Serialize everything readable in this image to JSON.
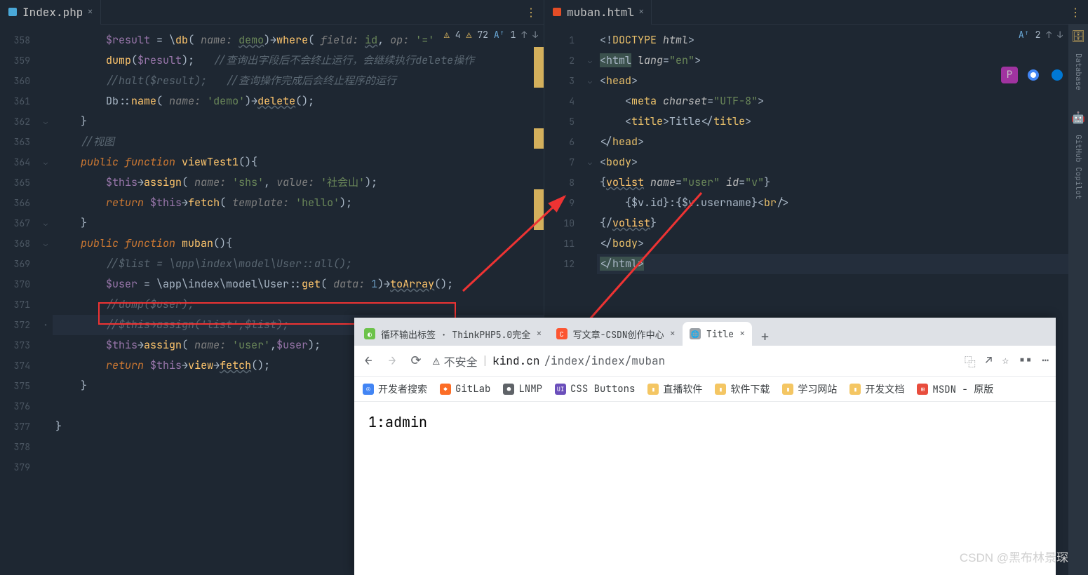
{
  "ide": {
    "tab_left": {
      "name": "Index.php"
    },
    "tab_right": {
      "name": "muban.html"
    },
    "status_left": {
      "warn1": "4",
      "warn2": "72",
      "typo": "1"
    },
    "status_right": {
      "typo": "2"
    },
    "sidebar": {
      "database": "Database",
      "copilot": "GitHub Copilot"
    }
  },
  "left_gutter": [
    "358",
    "359",
    "360",
    "361",
    "362",
    "363",
    "364",
    "365",
    "366",
    "367",
    "368",
    "369",
    "370",
    "371",
    "372",
    "373",
    "374",
    "375",
    "376",
    "377",
    "378",
    "379"
  ],
  "right_gutter": [
    "1",
    "2",
    "3",
    "4",
    "5",
    "6",
    "7",
    "8",
    "9",
    "10",
    "11",
    "12"
  ],
  "left_code": [
    {
      "i": "        ",
      "t": [
        [
          "var",
          "$result"
        ],
        [
          "op",
          " = \\"
        ],
        [
          "fn",
          "db"
        ],
        [
          "op",
          "( "
        ],
        [
          "param",
          "name: "
        ],
        [
          "str und",
          "demo"
        ],
        [
          "op",
          ")→"
        ],
        [
          "fn",
          "where"
        ],
        [
          "op",
          "( "
        ],
        [
          "param",
          "field: "
        ],
        [
          "str und",
          "id"
        ],
        [
          "op",
          ", "
        ],
        [
          "param",
          "op: "
        ],
        [
          "str",
          "'='"
        ],
        [
          "op",
          "  "
        ]
      ]
    },
    {
      "i": "        ",
      "t": [
        [
          "fn",
          "dump"
        ],
        [
          "op",
          "("
        ],
        [
          "var",
          "$result"
        ],
        [
          "op",
          ");   "
        ],
        [
          "cm",
          "//查询出字段后不会终止运行，会继续执行delete操作"
        ]
      ]
    },
    {
      "i": "        ",
      "t": [
        [
          "cm",
          "//halt($result);   //查询操作完成后会终止程序的运行"
        ]
      ]
    },
    {
      "i": "        ",
      "t": [
        [
          "op",
          "Db::"
        ],
        [
          "fn",
          "name"
        ],
        [
          "op",
          "( "
        ],
        [
          "param",
          "name: "
        ],
        [
          "str",
          "'demo'"
        ],
        [
          "op",
          ")→"
        ],
        [
          "fn und",
          "delete"
        ],
        [
          "op",
          "();"
        ]
      ]
    },
    {
      "i": "    ",
      "t": [
        [
          "op",
          "}"
        ]
      ]
    },
    {
      "i": "    ",
      "t": [
        [
          "cm",
          "//视图"
        ]
      ]
    },
    {
      "i": "    ",
      "t": [
        [
          "kw",
          "public function "
        ],
        [
          "fn",
          "viewTest1"
        ],
        [
          "op",
          "(){"
        ]
      ]
    },
    {
      "i": "        ",
      "t": [
        [
          "var",
          "$this"
        ],
        [
          "op",
          "→"
        ],
        [
          "fn",
          "assign"
        ],
        [
          "op",
          "( "
        ],
        [
          "param",
          "name: "
        ],
        [
          "str",
          "'shs'"
        ],
        [
          "op",
          ", "
        ],
        [
          "param",
          "value: "
        ],
        [
          "str",
          "'社会山'"
        ],
        [
          "op",
          ");"
        ]
      ]
    },
    {
      "i": "        ",
      "t": [
        [
          "kw",
          "return "
        ],
        [
          "var",
          "$this"
        ],
        [
          "op",
          "→"
        ],
        [
          "fn",
          "fetch"
        ],
        [
          "op",
          "( "
        ],
        [
          "param",
          "template: "
        ],
        [
          "str",
          "'hello'"
        ],
        [
          "op",
          ");"
        ]
      ]
    },
    {
      "i": "    ",
      "t": [
        [
          "op",
          "}"
        ]
      ]
    },
    {
      "i": "    ",
      "t": [
        [
          "kw",
          "public function "
        ],
        [
          "fn",
          "muban"
        ],
        [
          "op",
          "(){"
        ]
      ]
    },
    {
      "i": "        ",
      "t": [
        [
          "cm",
          "//$list = \\app\\index\\model\\User::all();"
        ]
      ]
    },
    {
      "i": "        ",
      "t": [
        [
          "var",
          "$user"
        ],
        [
          "op",
          " = \\app\\index\\model\\User::"
        ],
        [
          "fn",
          "get"
        ],
        [
          "op",
          "( "
        ],
        [
          "param",
          "data: "
        ],
        [
          "num",
          "1"
        ],
        [
          "op",
          ")→"
        ],
        [
          "fn und",
          "toArray"
        ],
        [
          "op",
          "();"
        ]
      ]
    },
    {
      "i": "        ",
      "t": [
        [
          "cm",
          "//dump($user);"
        ]
      ]
    },
    {
      "i": "        ",
      "t": [
        [
          "cm",
          "//$this→assign('list',$list);"
        ]
      ]
    },
    {
      "i": "        ",
      "t": [
        [
          "var",
          "$this"
        ],
        [
          "op",
          "→"
        ],
        [
          "fn",
          "assign"
        ],
        [
          "op",
          "( "
        ],
        [
          "param",
          "name: "
        ],
        [
          "str",
          "'user'"
        ],
        [
          "op",
          ","
        ],
        [
          "var",
          "$user"
        ],
        [
          "op",
          ");"
        ]
      ]
    },
    {
      "i": "        ",
      "t": [
        [
          "kw",
          "return "
        ],
        [
          "var",
          "$this"
        ],
        [
          "op",
          "→"
        ],
        [
          "fn",
          "view"
        ],
        [
          "op",
          "→"
        ],
        [
          "fn und",
          "fetch"
        ],
        [
          "op",
          "();"
        ]
      ]
    },
    {
      "i": "    ",
      "t": [
        [
          "op",
          "}"
        ]
      ]
    },
    {
      "i": "",
      "t": []
    },
    {
      "i": "",
      "t": [
        [
          "op",
          "}"
        ]
      ]
    },
    {
      "i": "",
      "t": []
    },
    {
      "i": "",
      "t": []
    }
  ],
  "right_code": [
    {
      "i": "",
      "t": [
        [
          "op",
          "<!"
        ],
        [
          "tag",
          "DOCTYPE "
        ],
        [
          "attr",
          "html"
        ],
        [
          "op",
          ">"
        ]
      ]
    },
    {
      "i": "",
      "t": [
        [
          "op hl-tag",
          "<html"
        ],
        [
          "attr",
          " lang"
        ],
        [
          "op",
          "="
        ],
        [
          "str",
          "\"en\""
        ],
        [
          "op",
          ">"
        ]
      ]
    },
    {
      "i": "",
      "t": [
        [
          "op",
          "<"
        ],
        [
          "tag",
          "head"
        ],
        [
          "op",
          ">"
        ]
      ]
    },
    {
      "i": "    ",
      "t": [
        [
          "op",
          "<"
        ],
        [
          "tag",
          "meta "
        ],
        [
          "attr",
          "charset"
        ],
        [
          "op",
          "="
        ],
        [
          "str",
          "\"UTF-8\""
        ],
        [
          "op",
          ">"
        ]
      ]
    },
    {
      "i": "    ",
      "t": [
        [
          "op",
          "<"
        ],
        [
          "tag",
          "title"
        ],
        [
          "op",
          ">Title</"
        ],
        [
          "tag",
          "title"
        ],
        [
          "op",
          ">"
        ]
      ]
    },
    {
      "i": "",
      "t": [
        [
          "op",
          "</"
        ],
        [
          "tag",
          "head"
        ],
        [
          "op",
          ">"
        ]
      ]
    },
    {
      "i": "",
      "t": [
        [
          "op",
          "<"
        ],
        [
          "tag",
          "body"
        ],
        [
          "op",
          ">"
        ]
      ]
    },
    {
      "i": "",
      "t": [
        [
          "op",
          "{"
        ],
        [
          "fn und",
          "volist"
        ],
        [
          "attr",
          " name"
        ],
        [
          "op",
          "="
        ],
        [
          "str",
          "\"user\""
        ],
        [
          "attr",
          " id"
        ],
        [
          "op",
          "="
        ],
        [
          "str",
          "\"v\""
        ],
        [
          "op",
          "}"
        ]
      ]
    },
    {
      "i": "    ",
      "t": [
        [
          "op",
          "{$v.id}:{$v.username}<"
        ],
        [
          "tag",
          "br"
        ],
        [
          "op",
          "/>"
        ]
      ]
    },
    {
      "i": "",
      "t": [
        [
          "op",
          "{/"
        ],
        [
          "fn und",
          "volist"
        ],
        [
          "op",
          "}"
        ]
      ]
    },
    {
      "i": "",
      "t": [
        [
          "op",
          "</"
        ],
        [
          "tag",
          "body"
        ],
        [
          "op",
          ">"
        ]
      ]
    },
    {
      "i": "",
      "t": [
        [
          "op hl-tag",
          "</html>"
        ]
      ]
    }
  ],
  "browser": {
    "tabs": [
      {
        "title": "循环输出标签 · ThinkPHP5.0完全",
        "favicon_bg": "#6cc24a",
        "favicon_txt": "◐",
        "active": false
      },
      {
        "title": "写文章-CSDN创作中心",
        "favicon_bg": "#fc5531",
        "favicon_txt": "C",
        "active": false
      },
      {
        "title": "Title",
        "favicon_bg": "#9aa0a6",
        "favicon_txt": "🌐",
        "active": true
      }
    ],
    "url_unsafe": "不安全",
    "url_host": "kind.cn",
    "url_path": "/index/index/muban",
    "bookmarks": [
      {
        "label": "开发者搜索",
        "color": "#4285f4",
        "glyph": "◎"
      },
      {
        "label": "GitLab",
        "color": "#fc6d26",
        "glyph": "◆"
      },
      {
        "label": "LNMP",
        "color": "#5f6368",
        "glyph": "●"
      },
      {
        "label": "CSS Buttons",
        "color": "#6b4fbb",
        "glyph": "UI"
      },
      {
        "label": "直播软件",
        "color": "#f4c663",
        "glyph": "▮"
      },
      {
        "label": "软件下载",
        "color": "#f4c663",
        "glyph": "▮"
      },
      {
        "label": "学习网站",
        "color": "#f4c663",
        "glyph": "▮"
      },
      {
        "label": "开发文档",
        "color": "#f4c663",
        "glyph": "▮"
      },
      {
        "label": "MSDN - 原版",
        "color": "#e84d3d",
        "glyph": "⊞"
      }
    ],
    "content": "1:admin"
  },
  "watermark": "CSDN @黑布林景琛"
}
